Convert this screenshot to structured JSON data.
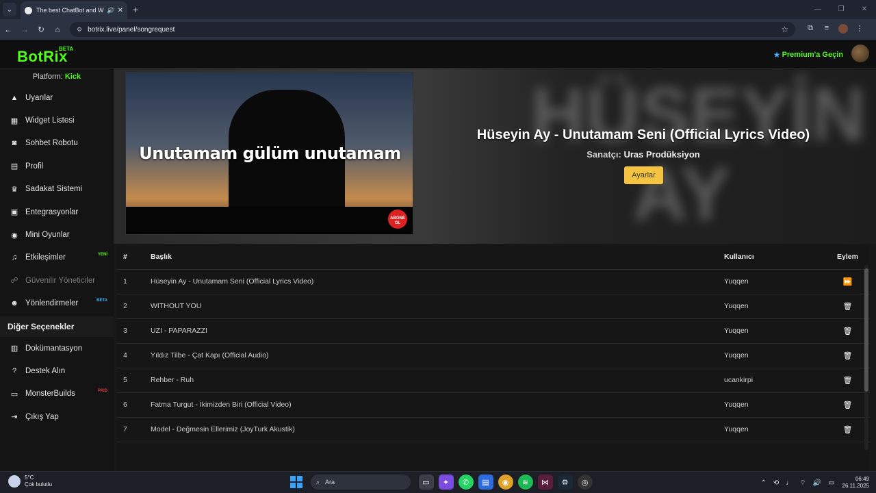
{
  "browser": {
    "tab_title": "The best ChatBot and Widg",
    "url": "botrix.live/panel/songrequest"
  },
  "header": {
    "logo": "BotRix",
    "beta": "BETA",
    "premium": "Premium'a Geçin"
  },
  "sidebar": {
    "platform_label": "Platform:",
    "platform_value": "Kick",
    "items": [
      {
        "label": "Uyarılar",
        "icon": "warning-icon"
      },
      {
        "label": "Widget Listesi",
        "icon": "grid-icon"
      },
      {
        "label": "Sohbet Robotu",
        "icon": "robot-icon"
      },
      {
        "label": "Profil",
        "icon": "id-card-icon"
      },
      {
        "label": "Sadakat Sistemi",
        "icon": "trophy-icon"
      },
      {
        "label": "Entegrasyonlar",
        "icon": "server-icon"
      },
      {
        "label": "Mini Oyunlar",
        "icon": "gamepad-icon"
      },
      {
        "label": "Etkileşimler",
        "icon": "music-icon",
        "badge": "YENİ"
      },
      {
        "label": "Güvenilir Yöneticiler",
        "icon": "users-cog-icon"
      },
      {
        "label": "Yönlendirmeler",
        "icon": "users-icon",
        "badge": "BETA"
      }
    ],
    "section_title": "Diğer Seçenekler",
    "other_items": [
      {
        "label": "Dokümantasyon",
        "icon": "scroll-icon"
      },
      {
        "label": "Destek Alın",
        "icon": "question-icon"
      },
      {
        "label": "MonsterBuilds",
        "icon": "laptop-icon",
        "badge": "PAID"
      },
      {
        "label": "Çıkış Yap",
        "icon": "logout-icon"
      }
    ]
  },
  "player": {
    "lyric_overlay": "Unutamam gülüm unutamam",
    "abone": "ABONE OL",
    "bg_text": "HÜSEYİN AY",
    "title": "Hüseyin Ay - Unutamam Seni (Official Lyrics Video)",
    "artist_label": "Sanatçı:",
    "artist": "Uras Prodüksiyon",
    "settings_button": "Ayarlar"
  },
  "table": {
    "headers": {
      "num": "#",
      "title": "Başlık",
      "user": "Kullanıcı",
      "action": "Eylem"
    },
    "rows": [
      {
        "num": "1",
        "title": "Hüseyin Ay - Unutamam Seni (Official Lyrics Video)",
        "user": "Yuqqen",
        "action": "skip"
      },
      {
        "num": "2",
        "title": "WITHOUT YOU",
        "user": "Yuqqen",
        "action": "delete"
      },
      {
        "num": "3",
        "title": "UZI - PAPARAZZI",
        "user": "Yuqqen",
        "action": "delete"
      },
      {
        "num": "4",
        "title": "Yıldız Tilbe - Çat Kapı (Official Audio)",
        "user": "Yuqqen",
        "action": "delete"
      },
      {
        "num": "5",
        "title": "Rehber - Ruh",
        "user": "ucankirpi",
        "action": "delete"
      },
      {
        "num": "6",
        "title": "Fatma Turgut - İkimizden Biri (Official Video)",
        "user": "Yuqqen",
        "action": "delete"
      },
      {
        "num": "7",
        "title": "Model - Değmesin Ellerimiz (JoyTurk Akustik)",
        "user": "Yuqqen",
        "action": "delete"
      }
    ]
  },
  "taskbar": {
    "temp": "5°C",
    "weather": "Çok bulutlu",
    "search": "Ara",
    "time": "06:49",
    "date": "26.11.2025"
  }
}
